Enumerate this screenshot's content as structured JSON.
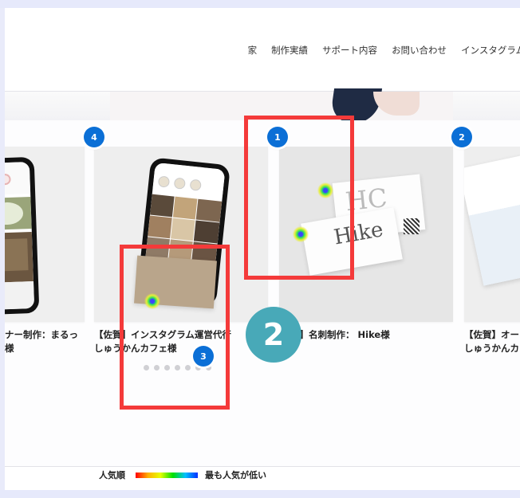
{
  "nav": {
    "items": [
      "家",
      "制作実績",
      "サポート内容",
      "お問い合わせ",
      "インスタグラム"
    ]
  },
  "cards": [
    {
      "title_line1": "ナー制作：まるっ",
      "title_line2": "様"
    },
    {
      "title_line1": "【佐賀】インスタグラム運営代行",
      "title_line2": "しゅうかんカフェ様"
    },
    {
      "title_line1": "分】名刺制作： Hike様",
      "title_line2": ""
    },
    {
      "title_line1": "【佐賀】オー",
      "title_line2": "しゅうかんカ"
    }
  ],
  "business_card": {
    "brand": "Hike",
    "monogram": "HC"
  },
  "badges": [
    "4",
    "1",
    "2",
    "3"
  ],
  "step_marker": "2",
  "legend": {
    "left": "人気順",
    "right": "最も人気が低い"
  },
  "colors": {
    "accent": "#0b6fd6",
    "highlight": "#f43a3a",
    "step": "#48a9b8"
  }
}
